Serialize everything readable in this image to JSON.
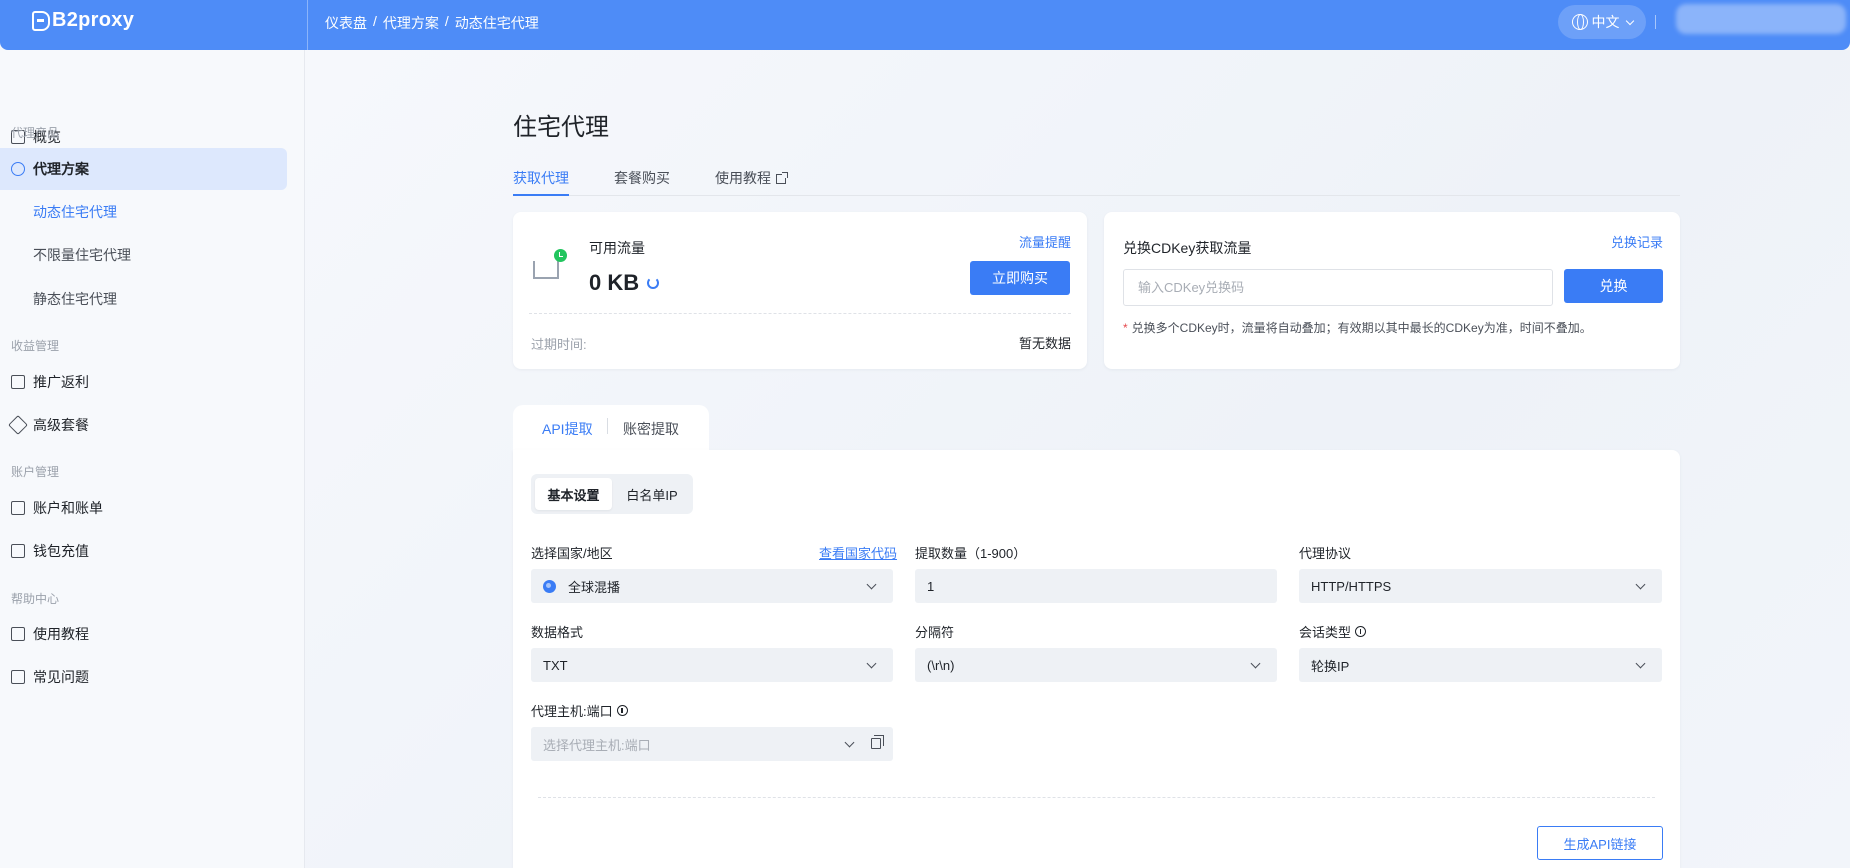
{
  "app": {
    "brand": "B2proxy",
    "brand_color": "#4e8cf7",
    "accent": "#3a7cf5"
  },
  "header": {
    "breadcrumb": [
      "仪表盘",
      "/",
      "代理方案",
      "/",
      "动态住宅代理"
    ],
    "language": "中文"
  },
  "sidebar": {
    "overview": "概览",
    "groups": {
      "proxy_products": "代理产品",
      "revenue": "收益管理",
      "account": "账户管理",
      "help": "帮助中心"
    },
    "proxy_plan": "代理方案",
    "sub_items": [
      "动态住宅代理",
      "不限量住宅代理",
      "静态住宅代理"
    ],
    "revenue_items": [
      "推广返利",
      "高级套餐"
    ],
    "account_items": [
      "账户和账单",
      "钱包充值"
    ],
    "help_items": [
      "使用教程",
      "常见问题"
    ]
  },
  "page": {
    "title": "住宅代理",
    "tabs": [
      "获取代理",
      "套餐购买",
      "使用教程"
    ]
  },
  "flow_card": {
    "label": "可用流量",
    "value": "0 KB",
    "alert_link": "流量提醒",
    "buy_button": "立即购买",
    "expiry_label": "过期时间:",
    "expiry_value": "暂无数据"
  },
  "cdkey_card": {
    "title": "兑换CDKey获取流量",
    "history_link": "兑换记录",
    "input_placeholder": "输入CDKey兑换码",
    "redeem_button": "兑换",
    "note": "兑换多个CDKey时，流量将自动叠加；有效期以其中最长的CDKey为准，时间不叠加。"
  },
  "api": {
    "tabs": [
      "API提取",
      "账密提取"
    ],
    "segments": [
      "基本设置",
      "白名单IP"
    ],
    "fields": {
      "country_label": "选择国家/地区",
      "country_link": "查看国家代码",
      "country_value": "全球混播",
      "quantity_label": "提取数量（1-900）",
      "quantity_value": "1",
      "protocol_label": "代理协议",
      "protocol_value": "HTTP/HTTPS",
      "format_label": "数据格式",
      "format_value": "TXT",
      "separator_label": "分隔符",
      "separator_value": "(\\r\\n)",
      "session_label": "会话类型",
      "session_value": "轮换IP",
      "host_label": "代理主机:端口",
      "host_placeholder": "选择代理主机:端口"
    },
    "generate_button": "生成API链接"
  }
}
